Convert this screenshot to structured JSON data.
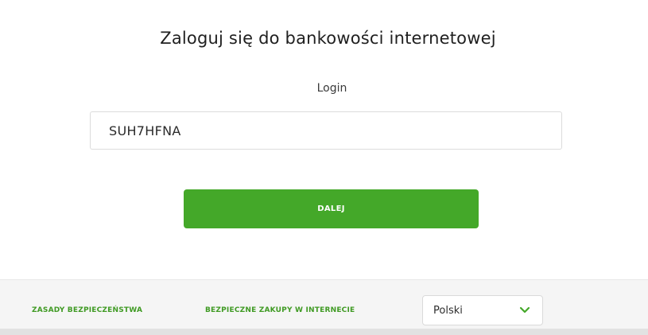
{
  "colors": {
    "accent_green": "#44a829",
    "link_green": "#3f9a23",
    "footer_background": "#f5f5f5"
  },
  "login": {
    "title": "Zaloguj się do bankowości internetowej",
    "field_label": "Login",
    "field_value": "SUH7HFNA",
    "submit_label": "DALEJ"
  },
  "footer": {
    "links": [
      {
        "label": "ZASADY BEZPIECZEŃSTWA"
      },
      {
        "label": "BEZPIECZNE ZAKUPY W INTERNECIE"
      }
    ],
    "language": {
      "selected": "Polski",
      "icon": "chevron-down-icon"
    }
  }
}
